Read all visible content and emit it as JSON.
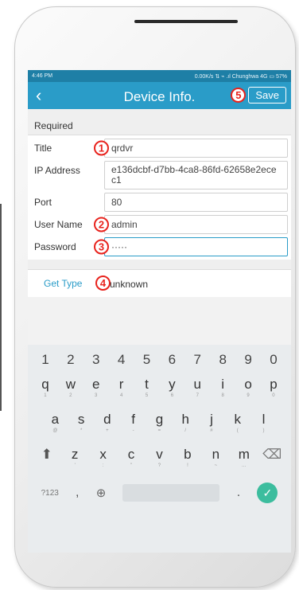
{
  "status_bar": {
    "time": "4:46 PM",
    "right": "0.00K/s ⇅ ⌁ .ıl Chunghwa 4G ▭ 57%"
  },
  "app_bar": {
    "back_glyph": "‹",
    "title": "Device Info.",
    "save_label": "Save"
  },
  "badges": [
    "1",
    "2",
    "3",
    "4",
    "5"
  ],
  "section": {
    "title": "Required"
  },
  "form": {
    "title": {
      "label": "Title",
      "value": "qrdvr"
    },
    "ip": {
      "label": "IP Address",
      "value": "e136dcbf-d7bb-4ca8-86fd-62658e2ecec1"
    },
    "port": {
      "label": "Port",
      "value": "80"
    },
    "user": {
      "label": "User Name",
      "value": "admin"
    },
    "password": {
      "label": "Password",
      "value": "·····"
    }
  },
  "get_type": {
    "label": "Get Type",
    "value": "unknown"
  },
  "keyboard": {
    "numbers": [
      "1",
      "2",
      "3",
      "4",
      "5",
      "6",
      "7",
      "8",
      "9",
      "0"
    ],
    "row1": [
      [
        "q",
        "1"
      ],
      [
        "w",
        "2"
      ],
      [
        "e",
        "3"
      ],
      [
        "r",
        "4"
      ],
      [
        "t",
        "5"
      ],
      [
        "y",
        "6"
      ],
      [
        "u",
        "7"
      ],
      [
        "i",
        "8"
      ],
      [
        "o",
        "9"
      ],
      [
        "p",
        "0"
      ]
    ],
    "row2": [
      [
        "a",
        "@"
      ],
      [
        "s",
        "*"
      ],
      [
        "d",
        "+"
      ],
      [
        "f",
        "-"
      ],
      [
        "g",
        "="
      ],
      [
        "h",
        "/"
      ],
      [
        "j",
        "#"
      ],
      [
        "k",
        "("
      ],
      [
        "l",
        ")"
      ]
    ],
    "row3": [
      [
        "z",
        "'"
      ],
      [
        "x",
        ":"
      ],
      [
        "c",
        "\""
      ],
      [
        "v",
        "?"
      ],
      [
        "b",
        "!"
      ],
      [
        "n",
        "~"
      ],
      [
        "m",
        "…"
      ]
    ],
    "sym_label": "?123",
    "comma": ",",
    "period": ".",
    "shift_glyph": "⬆",
    "backspace_glyph": "⌫",
    "globe_glyph": "⊕",
    "enter_glyph": "✓"
  }
}
